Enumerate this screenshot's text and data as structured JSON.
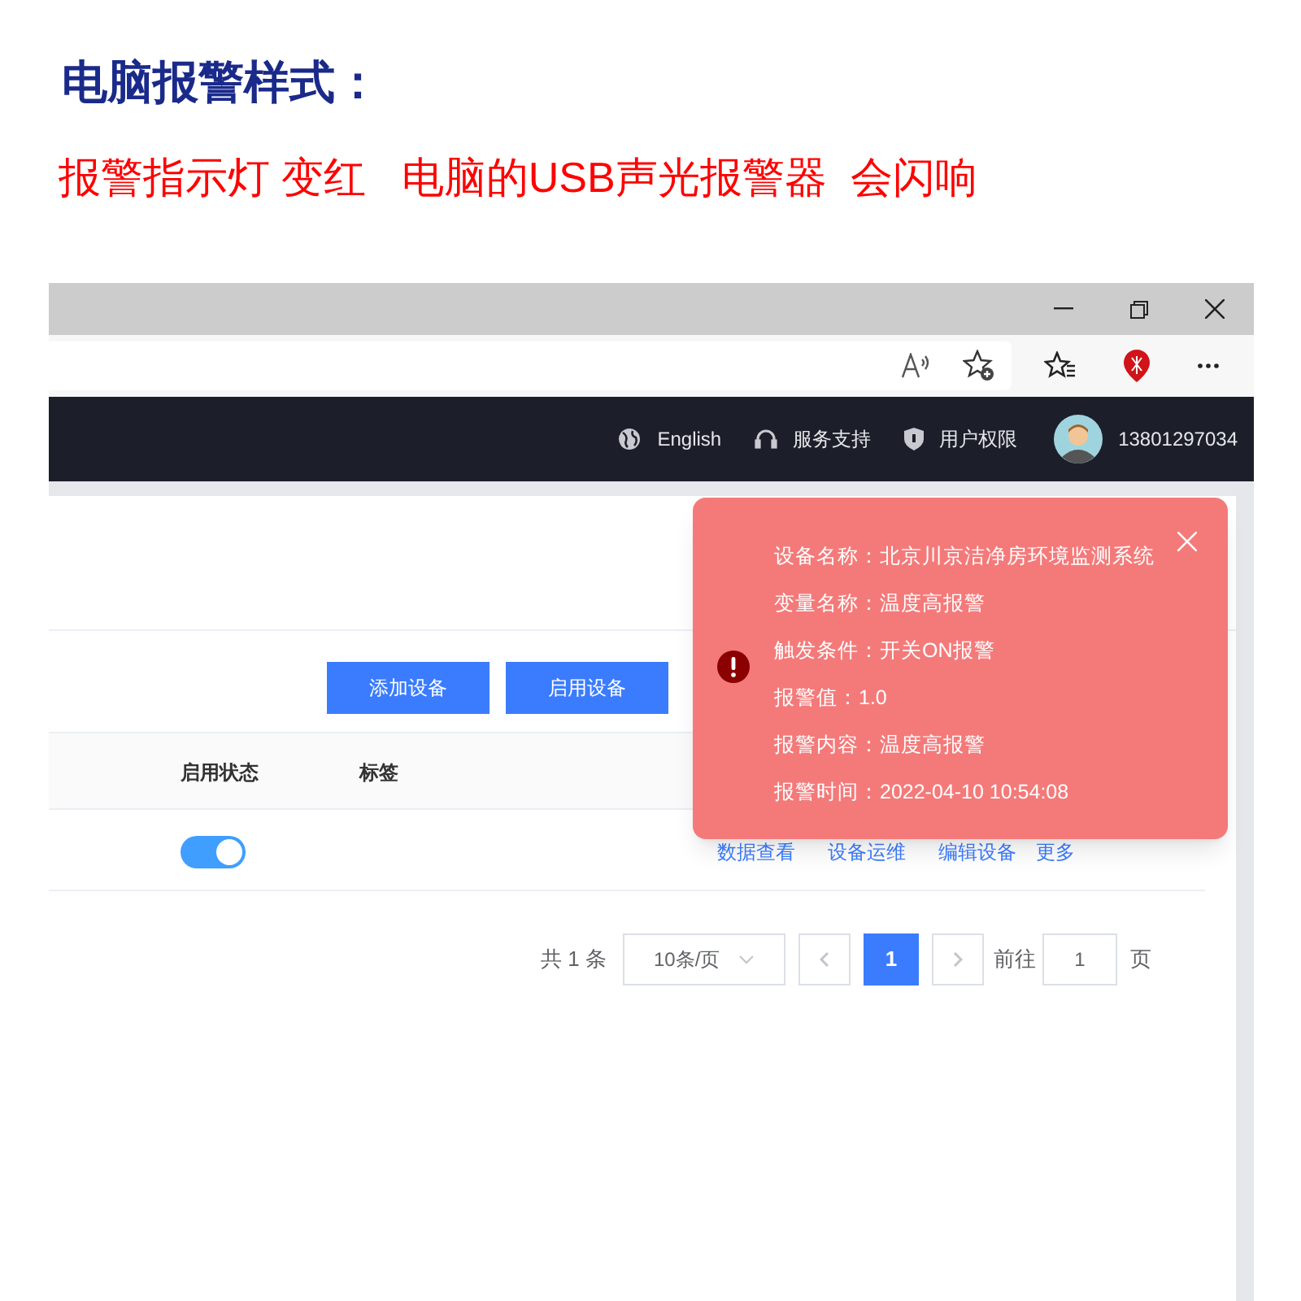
{
  "heading": "电脑报警样式：",
  "subheading": "报警指示灯 变红   电脑的USB声光报警器  会闪响",
  "navbar": {
    "items": [
      "English",
      "服务支持",
      "用户权限"
    ],
    "user": "13801297034"
  },
  "toolbar": {
    "buttons": [
      "添加设备",
      "启用设备"
    ]
  },
  "table": {
    "columns": [
      "启用状态",
      "标签"
    ],
    "rows": [
      {
        "enabled": true,
        "actions": [
          "数据查看",
          "设备运维",
          "编辑设备",
          "更多"
        ]
      }
    ]
  },
  "pagination": {
    "total": "共 1 条",
    "page_size": "10条/页",
    "pages": [
      {
        "label": "1",
        "selected": true
      }
    ],
    "goto_label": "前往",
    "goto_value": "1",
    "goto_suffix": "页"
  },
  "alert": {
    "lines": [
      {
        "label": "设备名称：",
        "value": "北京川京洁净房环境监测系统"
      },
      {
        "label": "变量名称：",
        "value": "温度高报警"
      },
      {
        "label": "触发条件：",
        "value": "开关ON报警"
      },
      {
        "label": "报警值：",
        "value": "1.0"
      },
      {
        "label": "报警内容：",
        "value": "温度高报警"
      },
      {
        "label": "报警时间：",
        "value": "2022-04-10 10:54:08"
      }
    ]
  }
}
